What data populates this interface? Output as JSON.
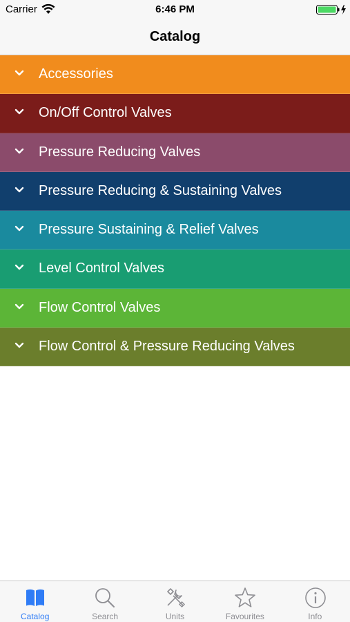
{
  "status_bar": {
    "carrier": "Carrier",
    "time": "6:46 PM"
  },
  "nav": {
    "title": "Catalog"
  },
  "catalog": {
    "items": [
      {
        "label": "Accessories",
        "color": "#f18c1d"
      },
      {
        "label": "On/Off Control Valves",
        "color": "#7b1c1a"
      },
      {
        "label": "Pressure Reducing Valves",
        "color": "#8b4b6b"
      },
      {
        "label": "Pressure Reducing & Sustaining Valves",
        "color": "#113f6d"
      },
      {
        "label": "Pressure Sustaining & Relief Valves",
        "color": "#1a8a9e"
      },
      {
        "label": "Level Control Valves",
        "color": "#199d72"
      },
      {
        "label": "Flow Control Valves",
        "color": "#5cb537"
      },
      {
        "label": "Flow Control & Pressure Reducing Valves",
        "color": "#6b7e2c"
      }
    ]
  },
  "tabs": [
    {
      "label": "Catalog",
      "icon": "book-icon",
      "active": true
    },
    {
      "label": "Search",
      "icon": "search-icon",
      "active": false
    },
    {
      "label": "Units",
      "icon": "tools-icon",
      "active": false
    },
    {
      "label": "Favourites",
      "icon": "star-icon",
      "active": false
    },
    {
      "label": "Info",
      "icon": "info-icon",
      "active": false
    }
  ],
  "colors": {
    "accent": "#2f7cf6",
    "inactive": "#8e8e93",
    "battery": "#4cd964"
  }
}
